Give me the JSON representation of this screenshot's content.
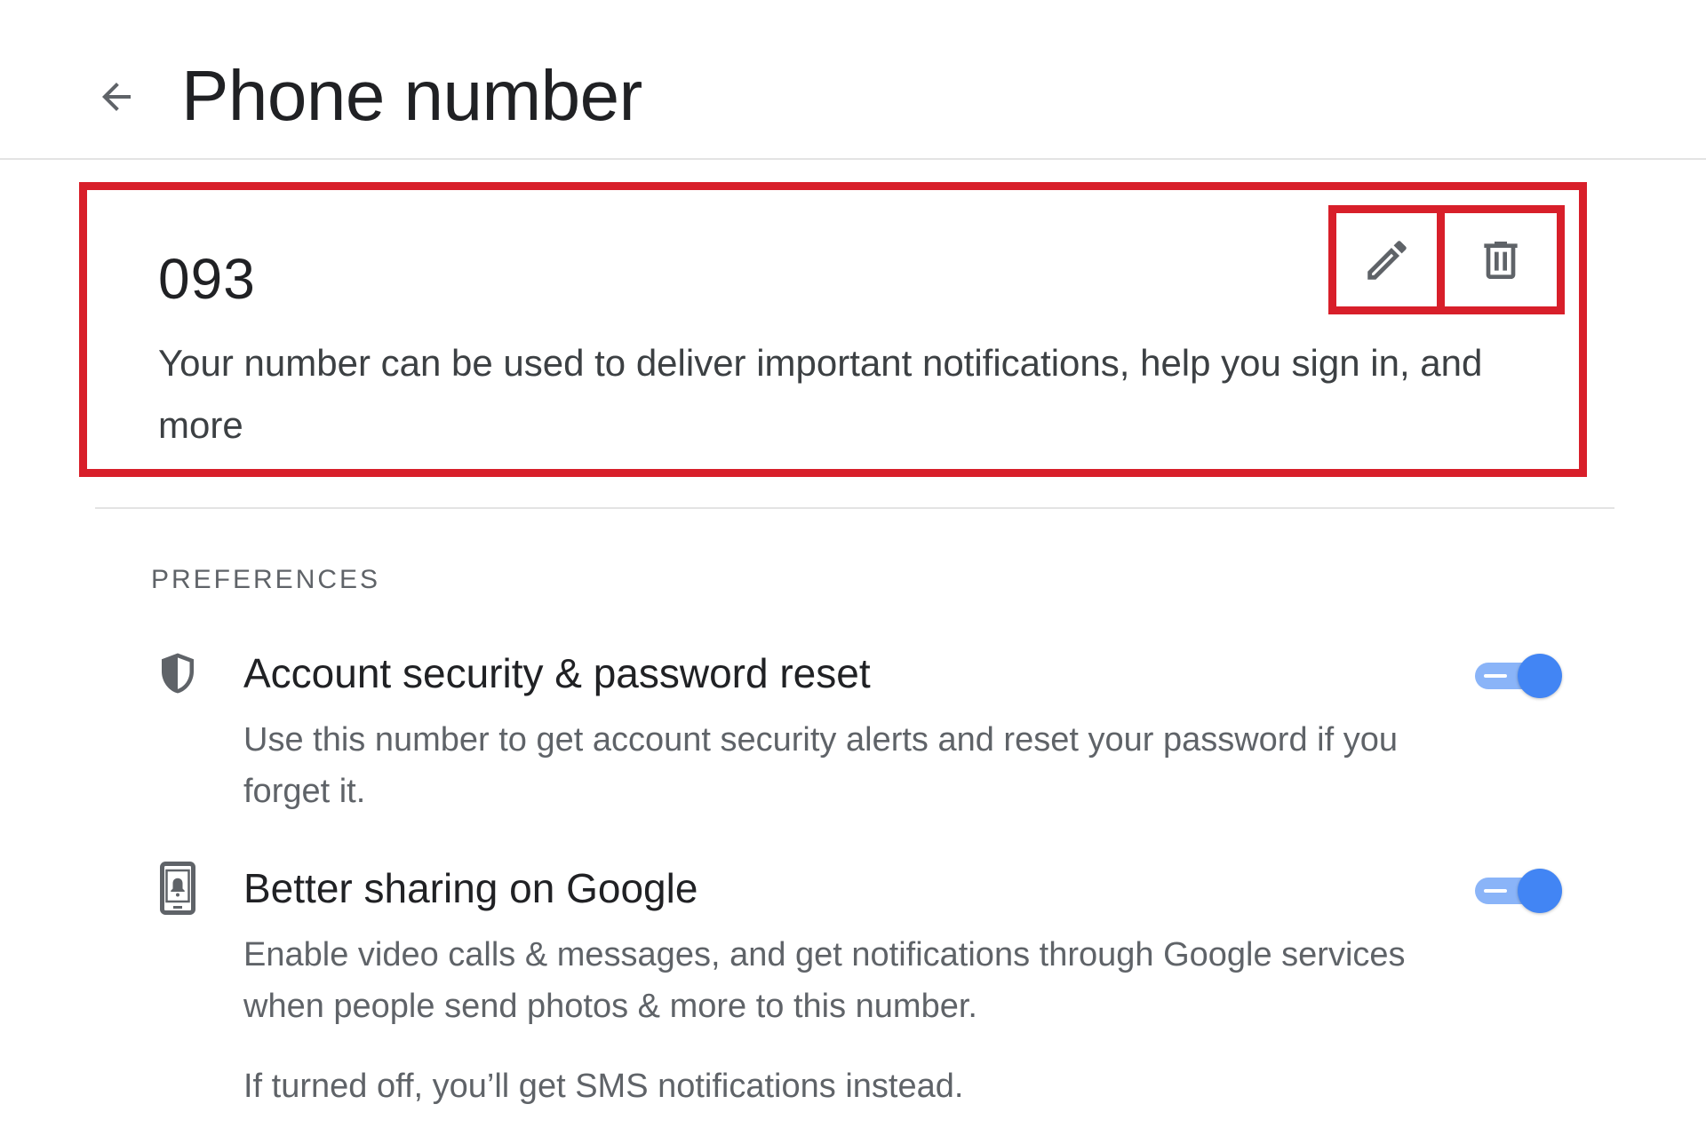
{
  "header": {
    "back_icon": "arrow-back-icon",
    "title": "Phone number"
  },
  "phone": {
    "number": "093",
    "description": "Your number can be used to deliver important notifications, help you sign in, and more",
    "edit_icon": "pencil-icon",
    "delete_icon": "trash-icon"
  },
  "preferences": {
    "label": "PREFERENCES",
    "items": [
      {
        "icon": "shield-icon",
        "title": "Account security & password reset",
        "description": "Use this number to get account security alerts and reset your password if you forget it.",
        "enabled": true
      },
      {
        "icon": "phone-notification-icon",
        "title": "Better sharing on Google",
        "description": "Enable video calls & messages, and get notifications through Google services when people send photos & more to this number.",
        "extra": "If turned off, you’ll get SMS notifications instead.",
        "enabled": true
      }
    ]
  },
  "colors": {
    "accent": "#4285f4",
    "toggle_track": "#8ab4f8",
    "highlight_border": "#d81f2a",
    "text_primary": "#202124",
    "text_secondary": "#5f6368"
  }
}
